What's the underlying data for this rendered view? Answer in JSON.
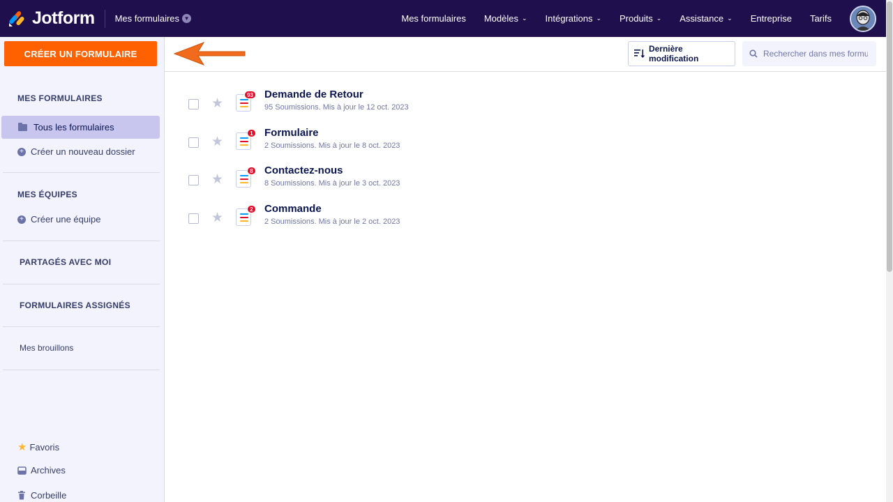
{
  "header": {
    "logo_text": "Jotform",
    "myforms_label": "Mes formulaires",
    "nav": [
      {
        "label": "Mes formulaires",
        "has_menu": false
      },
      {
        "label": "Modèles",
        "has_menu": true
      },
      {
        "label": "Intégrations",
        "has_menu": true
      },
      {
        "label": "Produits",
        "has_menu": true
      },
      {
        "label": "Assistance",
        "has_menu": true
      },
      {
        "label": "Entreprise",
        "has_menu": false
      },
      {
        "label": "Tarifs",
        "has_menu": false
      }
    ]
  },
  "sidebar": {
    "create_label": "CRÉER UN FORMULAIRE",
    "my_forms_heading": "MES FORMULAIRES",
    "all_forms": "Tous les formulaires",
    "new_folder": "Créer un nouveau dossier",
    "my_teams_heading": "MES ÉQUIPES",
    "create_team": "Créer une équipe",
    "shared_heading": "PARTAGÉS AVEC MOI",
    "assigned_heading": "FORMULAIRES ASSIGNÉS",
    "drafts": "Mes brouillons",
    "favorites": "Favoris",
    "archives": "Archives",
    "trash": "Corbeille"
  },
  "toolbar": {
    "sort_label": "Dernière modification",
    "search_placeholder": "Rechercher dans mes formulaires"
  },
  "forms": [
    {
      "title": "Demande de Retour",
      "meta": "95 Soumissions. Mis à jour le 12 oct. 2023",
      "badge": "93"
    },
    {
      "title": "Formulaire",
      "meta": "2 Soumissions. Mis à jour le 8 oct. 2023",
      "badge": "1"
    },
    {
      "title": "Contactez-nous",
      "meta": "8 Soumissions. Mis à jour le 3 oct. 2023",
      "badge": "8"
    },
    {
      "title": "Commande",
      "meta": "2 Soumissions. Mis à jour le 2 oct. 2023",
      "badge": "2"
    }
  ],
  "colors": {
    "topbar": "#1f0f4d",
    "accent": "#ff6100",
    "sidebar_bg": "#f3f3fe",
    "active_item": "#c8c6ee",
    "badge": "#e00b26"
  }
}
